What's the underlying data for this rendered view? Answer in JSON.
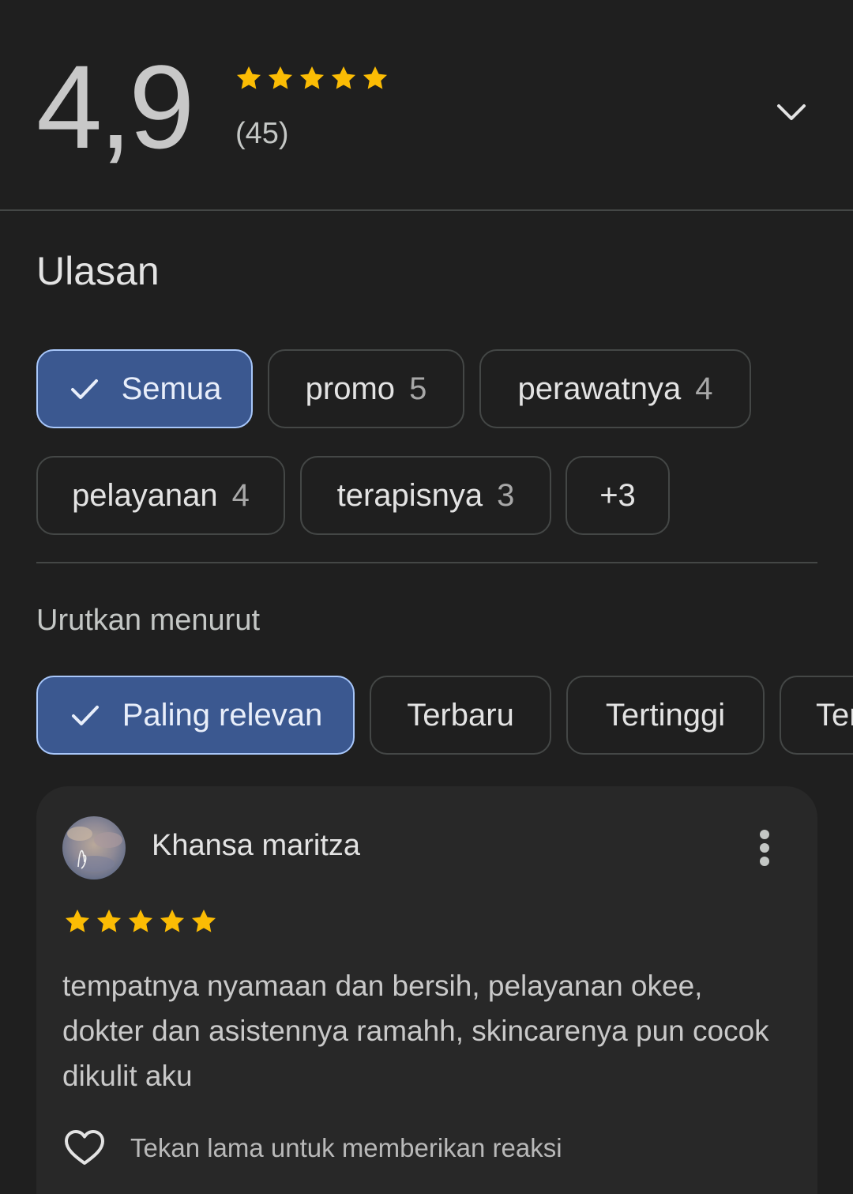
{
  "rating": {
    "score": "4,9",
    "review_count": "(45)",
    "star_color": "#fbbc04",
    "expand_icon": "chevron-down-icon"
  },
  "reviews_section": {
    "title": "Ulasan",
    "topic_chips": [
      {
        "label": "Semua",
        "count": "",
        "selected": true
      },
      {
        "label": "promo",
        "count": "5",
        "selected": false
      },
      {
        "label": "perawatnya",
        "count": "4",
        "selected": false
      },
      {
        "label": "pelayanan",
        "count": "4",
        "selected": false
      },
      {
        "label": "terapisnya",
        "count": "3",
        "selected": false
      },
      {
        "label": "+3",
        "count": "",
        "selected": false
      }
    ]
  },
  "sort": {
    "label": "Urutkan menurut",
    "options": [
      {
        "label": "Paling relevan",
        "selected": true
      },
      {
        "label": "Terbaru",
        "selected": false
      },
      {
        "label": "Tertinggi",
        "selected": false
      },
      {
        "label": "Ter",
        "selected": false
      }
    ]
  },
  "review": {
    "author": "Khansa maritza",
    "stars": 5,
    "text": "tempatnya nyamaan dan bersih, pelayanan okee, dokter dan asistennya ramahh, skincarenya pun cocok dikulit aku",
    "reaction_hint": "Tekan lama untuk memberikan reaksi",
    "menu_icon": "more-vertical-icon",
    "reaction_icon": "heart-outline-icon"
  },
  "colors": {
    "background": "#1f1f1f",
    "card": "#282828",
    "chip_selected_bg": "#3b5890",
    "chip_selected_border": "#a8c7fa",
    "chip_border": "#444746"
  }
}
